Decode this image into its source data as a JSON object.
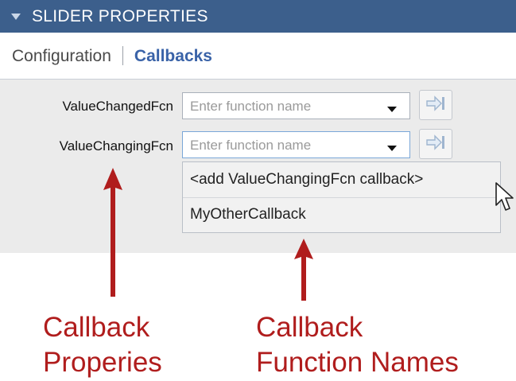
{
  "panel": {
    "title": "SLIDER PROPERTIES"
  },
  "tabs": [
    {
      "label": "Configuration",
      "active": false
    },
    {
      "label": "Callbacks",
      "active": true
    }
  ],
  "properties": [
    {
      "label": "ValueChangedFcn",
      "placeholder": "Enter function name",
      "focused": false
    },
    {
      "label": "ValueChangingFcn",
      "placeholder": "Enter function name",
      "focused": true
    }
  ],
  "dropdown_options": [
    "<add ValueChangingFcn callback>",
    "MyOtherCallback"
  ],
  "annotations": {
    "left": [
      "Callback",
      "Properies"
    ],
    "right": [
      "Callback",
      "Function Names"
    ]
  },
  "colors": {
    "header_bg": "#3c5f8c",
    "active_tab": "#3a63a8",
    "annotation": "#b01d1d"
  },
  "icons": [
    "collapse-triangle-icon",
    "chevron-down-icon",
    "go-to-callback-icon",
    "mouse-pointer-icon",
    "arrow-up-icon"
  ]
}
